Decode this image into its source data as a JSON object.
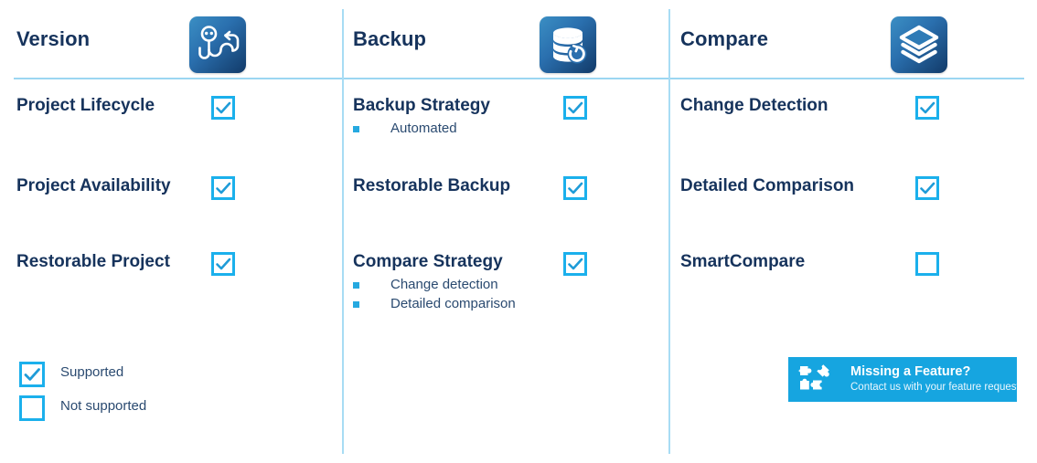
{
  "colors": {
    "accent_cyan": "#1bb0ec",
    "heading_navy": "#16335c",
    "divider_blue": "#9bd6f2",
    "tile_gradient_start": "#3b8fc4",
    "tile_gradient_end": "#123a68",
    "banner_bg": "#16a5e0",
    "bullet_blue": "#26a9e0"
  },
  "columns": [
    {
      "title": "Version",
      "icon": "version-branch-icon",
      "features": [
        {
          "label": "Project Lifecycle",
          "checked": true,
          "sub": []
        },
        {
          "label": "Project Availability",
          "checked": true,
          "sub": []
        },
        {
          "label": "Restorable Project",
          "checked": true,
          "sub": []
        }
      ]
    },
    {
      "title": "Backup",
      "icon": "database-refresh-icon",
      "features": [
        {
          "label": "Backup Strategy",
          "checked": true,
          "sub": [
            "Automated"
          ]
        },
        {
          "label": "Restorable Backup",
          "checked": true,
          "sub": []
        },
        {
          "label": "Compare Strategy",
          "checked": true,
          "sub": [
            "Change detection",
            "Detailed comparison"
          ]
        }
      ]
    },
    {
      "title": "Compare",
      "icon": "layers-stack-icon",
      "features": [
        {
          "label": "Change Detection",
          "checked": true,
          "sub": []
        },
        {
          "label": "Detailed Comparison",
          "checked": true,
          "sub": []
        },
        {
          "label": "SmartCompare",
          "checked": false,
          "sub": []
        }
      ]
    }
  ],
  "legend": {
    "supported": {
      "label": "Supported",
      "checked": true
    },
    "not_supported": {
      "label": "Not supported",
      "checked": false
    }
  },
  "banner": {
    "title": "Missing a Feature?",
    "subtitle": "Contact us with your feature request!",
    "icon": "puzzle-pieces-icon"
  }
}
